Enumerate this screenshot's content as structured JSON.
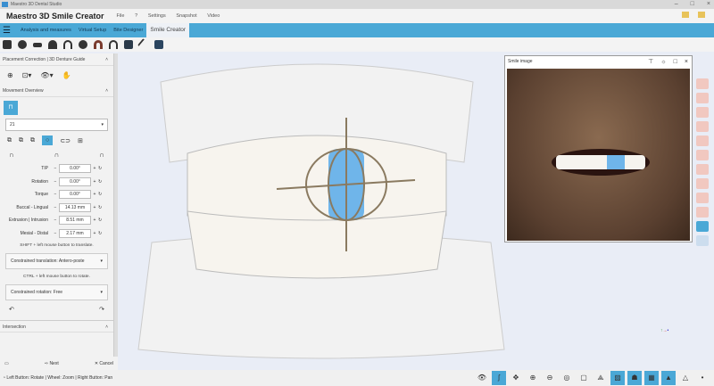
{
  "window": {
    "title": "Maestro 3D Dental Studio"
  },
  "header": {
    "app_name": "Maestro 3D Smile Creator",
    "menu": [
      "File",
      "?",
      "Settings",
      "Snapshot",
      "Video"
    ]
  },
  "tabs": [
    {
      "label": "Analysis and measures"
    },
    {
      "label": "Virtual Setup"
    },
    {
      "label": "Bite Designer"
    },
    {
      "label": "Smile Creator",
      "active": true
    }
  ],
  "left_panel": {
    "placement_section": "Placement Correction | 3D Denture Guide",
    "movement_section": "Movement Overview",
    "tooth_select": "21",
    "params": [
      {
        "label": "TIP",
        "value": "0.00°"
      },
      {
        "label": "Rotation",
        "value": "0.00°"
      },
      {
        "label": "Torque",
        "value": "0.00°"
      },
      {
        "label": "Buccal - Lingual",
        "value": "14.13 mm"
      },
      {
        "label": "Extrusion | Intrusion",
        "value": "8.51 mm"
      },
      {
        "label": "Mesial - Distal",
        "value": "2.17 mm"
      }
    ],
    "hint_translate": "SHIFT + left mouse button to translate.",
    "translation_select": "Constrained translation: Antero-poste",
    "hint_rotate": "CTRL + left mouse button to rotate.",
    "rotation_select": "Constrained rotation: Free",
    "intersection_section": "Intersection"
  },
  "bottom": {
    "next": "Next",
    "cancel": "Cancel"
  },
  "status": "Left Button: Rotate | Wheel: Zoom | Right Button: Pan",
  "smile_panel": {
    "title": "Smile image"
  },
  "colors": {
    "accent": "#4aa8d6",
    "selected_tooth": "#6fb5ea"
  }
}
